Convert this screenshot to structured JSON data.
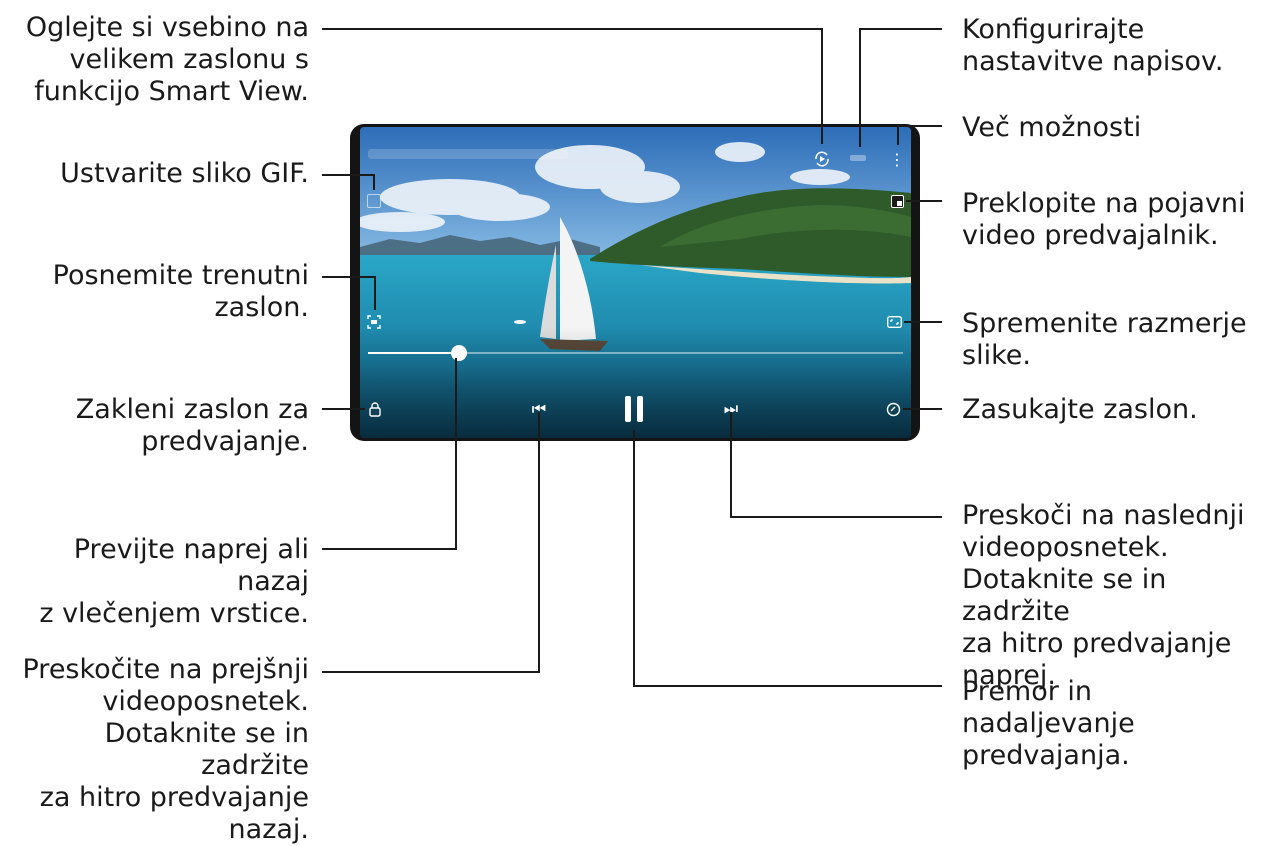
{
  "callouts": {
    "smart_view": "Oglejte si vsebino na\nvelikem zaslonu s\nfunkcijo Smart View.",
    "gif": "Ustvarite sliko GIF.",
    "capture": "Posnemite trenutni\nzaslon.",
    "lock": "Zakleni zaslon za\npredvajanje.",
    "seek": "Previjte naprej ali nazaj\nz vlečenjem vrstice.",
    "previous": "Preskočite na prejšnji\nvideoposnetek.\nDotaknite se in zadržite\nza hitro predvajanje\nnazaj.",
    "subtitles": "Konfigurirajte\nnastavitve napisov.",
    "more": "Več možnosti",
    "popup": "Preklopite na pojavni\nvideo predvajalnik.",
    "ratio": "Spremenite razmerje\nslike.",
    "rotate": "Zasukajte zaslon.",
    "next": "Preskoči na naslednji\nvideoposnetek.\nDotaknite se in zadržite\nza hitro predvajanje\nnaprej.",
    "pause": "Premor in nadaljevanje\npredvajanja."
  },
  "player": {
    "progress": 0.17,
    "icons": {
      "smart_view": "smart-view-icon",
      "gif": "gif-icon",
      "capture": "capture-icon",
      "lock": "lock-icon",
      "subtitles": "subtitles-icon",
      "more": "more-options-icon",
      "popup": "popup-player-icon",
      "ratio": "aspect-ratio-icon",
      "rotate": "rotate-icon",
      "previous": "previous-icon",
      "pause": "pause-icon",
      "next": "next-icon"
    }
  },
  "colors": {
    "sky": "#3f7fc4",
    "sea": "#1d8fb0",
    "island": "#2f5a2a",
    "line": "#1a1a1a"
  }
}
